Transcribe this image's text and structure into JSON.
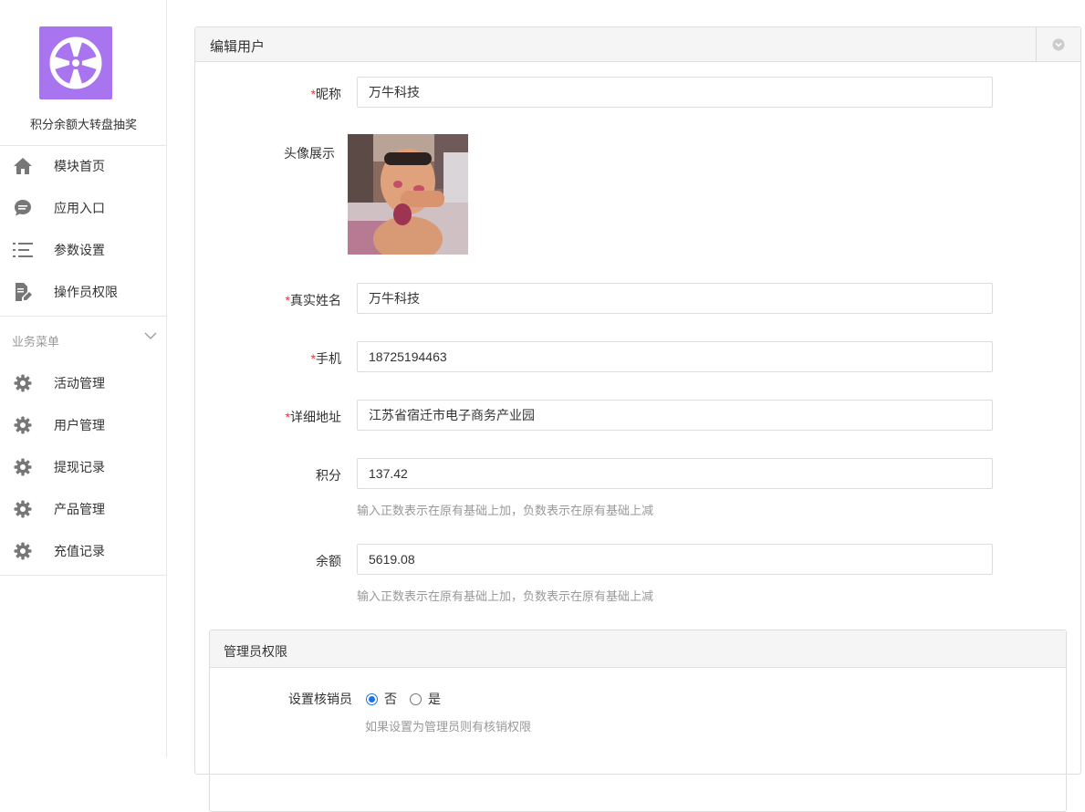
{
  "sidebar": {
    "app_name": "积分余额大转盘抽奖",
    "items": [
      {
        "label": "模块首页",
        "icon": "home-icon"
      },
      {
        "label": "应用入口",
        "icon": "chat-bubble-icon"
      },
      {
        "label": "参数设置",
        "icon": "list-icon"
      },
      {
        "label": "操作员权限",
        "icon": "document-edit-icon"
      }
    ],
    "group_title": "业务菜单",
    "group_items": [
      {
        "label": "活动管理",
        "icon": "gear-icon"
      },
      {
        "label": "用户管理",
        "icon": "gear-icon"
      },
      {
        "label": "提现记录",
        "icon": "gear-icon"
      },
      {
        "label": "产品管理",
        "icon": "gear-icon"
      },
      {
        "label": "充值记录",
        "icon": "gear-icon"
      }
    ]
  },
  "panel": {
    "title": "编辑用户",
    "fields": {
      "nickname": {
        "label": "昵称",
        "value": "万牛科技",
        "required": "*"
      },
      "avatar": {
        "label": "头像展示"
      },
      "realname": {
        "label": "真实姓名",
        "value": "万牛科技",
        "required": "*"
      },
      "mobile": {
        "label": "手机",
        "value": "18725194463",
        "required": "*"
      },
      "address": {
        "label": "详细地址",
        "value": "江苏省宿迁市电子商务产业园",
        "required": "*"
      },
      "credit": {
        "label": "积分",
        "value": "137.42",
        "help": "输入正数表示在原有基础上加，负数表示在原有基础上减"
      },
      "balance": {
        "label": "余额",
        "value": "5619.08",
        "help": "输入正数表示在原有基础上加，负数表示在原有基础上减"
      }
    }
  },
  "admin_panel": {
    "title": "管理员权限",
    "verifier": {
      "label": "设置核销员",
      "options": [
        "否",
        "是"
      ],
      "selected": "否",
      "help": "如果设置为管理员则有核销权限"
    }
  },
  "colors": {
    "logo_bg": "#a974f0",
    "required": "#e4393c",
    "radio_accent": "#1a73e8"
  }
}
